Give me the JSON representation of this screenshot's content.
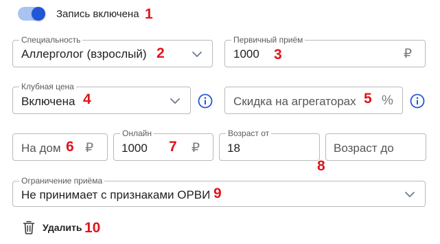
{
  "toggle": {
    "label": "Запись включена",
    "on": true,
    "color_on": "#1f57d6",
    "track_color": "#a9c4f2"
  },
  "specialty": {
    "label": "Специальность",
    "value": "Аллерголог (взрослый)",
    "icon": "chevron-down-icon"
  },
  "primary_visit": {
    "label": "Первичный приём",
    "value": "1000",
    "suffix": "₽"
  },
  "club_price": {
    "label": "Клубная цена",
    "value": "Включена",
    "icon": "chevron-down-icon",
    "info_icon": "info-icon"
  },
  "aggregator_discount": {
    "placeholder": "Скидка на агрегаторах",
    "suffix": "%",
    "info_icon": "info-icon"
  },
  "home": {
    "placeholder": "На дом",
    "suffix": "₽"
  },
  "online": {
    "label": "Онлайн",
    "value": "1000",
    "suffix": "₽"
  },
  "age_from": {
    "label": "Возраст от",
    "value": "18"
  },
  "age_to": {
    "placeholder": "Возраст до"
  },
  "restriction": {
    "label": "Ограничение приёма",
    "value": "Не принимает с признаками ОРВИ",
    "icon": "chevron-down-icon"
  },
  "delete": {
    "label": "Удалить",
    "icon": "trash-icon"
  },
  "markers": [
    "1",
    "2",
    "3",
    "4",
    "5",
    "6",
    "7",
    "8",
    "9",
    "10"
  ],
  "colors": {
    "accent": "#1f57d6",
    "marker": "#e0131b",
    "border": "#b9b9b9"
  }
}
